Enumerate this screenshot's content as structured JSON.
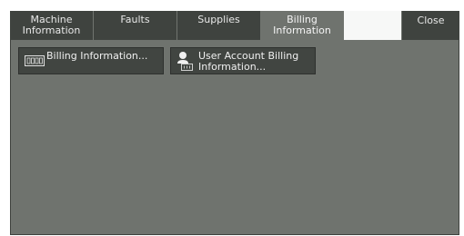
{
  "tabs": [
    {
      "label": "Machine\nInformation",
      "active": false
    },
    {
      "label": "Faults",
      "active": false
    },
    {
      "label": "Supplies",
      "active": false
    },
    {
      "label": "Billing\nInformation",
      "active": true
    }
  ],
  "close_label": "Close",
  "buttons": [
    {
      "label": "Billing Information...",
      "icon": "counter-icon"
    },
    {
      "label": "User Account Billing\nInformation...",
      "icon": "user-counter-icon"
    }
  ],
  "colors": {
    "panel": "#6f736e",
    "tab_dark": "#3f433f",
    "button": "#414541"
  }
}
